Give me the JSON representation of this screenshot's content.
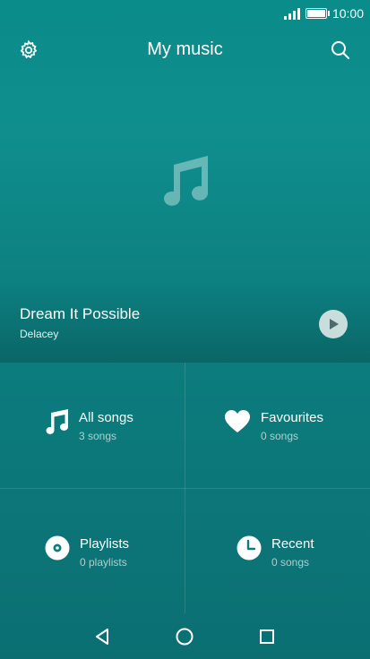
{
  "status_bar": {
    "time": "10:00",
    "signal_icon": "signal-bars-icon",
    "battery_icon": "battery-full-icon"
  },
  "header": {
    "title": "My music",
    "left_icon": "settings-gear-icon",
    "right_icon": "search-icon"
  },
  "now_playing": {
    "title": "Dream It Possible",
    "artist": "Delacey",
    "artwork_icon": "music-note-icon",
    "play_icon": "play-icon"
  },
  "categories": [
    {
      "label": "All songs",
      "sub": "3 songs",
      "icon": "music-note-icon"
    },
    {
      "label": "Favourites",
      "sub": "0 songs",
      "icon": "heart-icon"
    },
    {
      "label": "Playlists",
      "sub": "0 playlists",
      "icon": "disc-icon"
    },
    {
      "label": "Recent",
      "sub": "0 songs",
      "icon": "clock-icon"
    }
  ],
  "nav_bar": {
    "back_icon": "back-triangle-icon",
    "home_icon": "home-circle-icon",
    "recents_icon": "recents-square-icon"
  },
  "colors": {
    "background_top": "#0a8c8a",
    "background_bottom": "#0b6f72",
    "text": "#ffffff"
  }
}
